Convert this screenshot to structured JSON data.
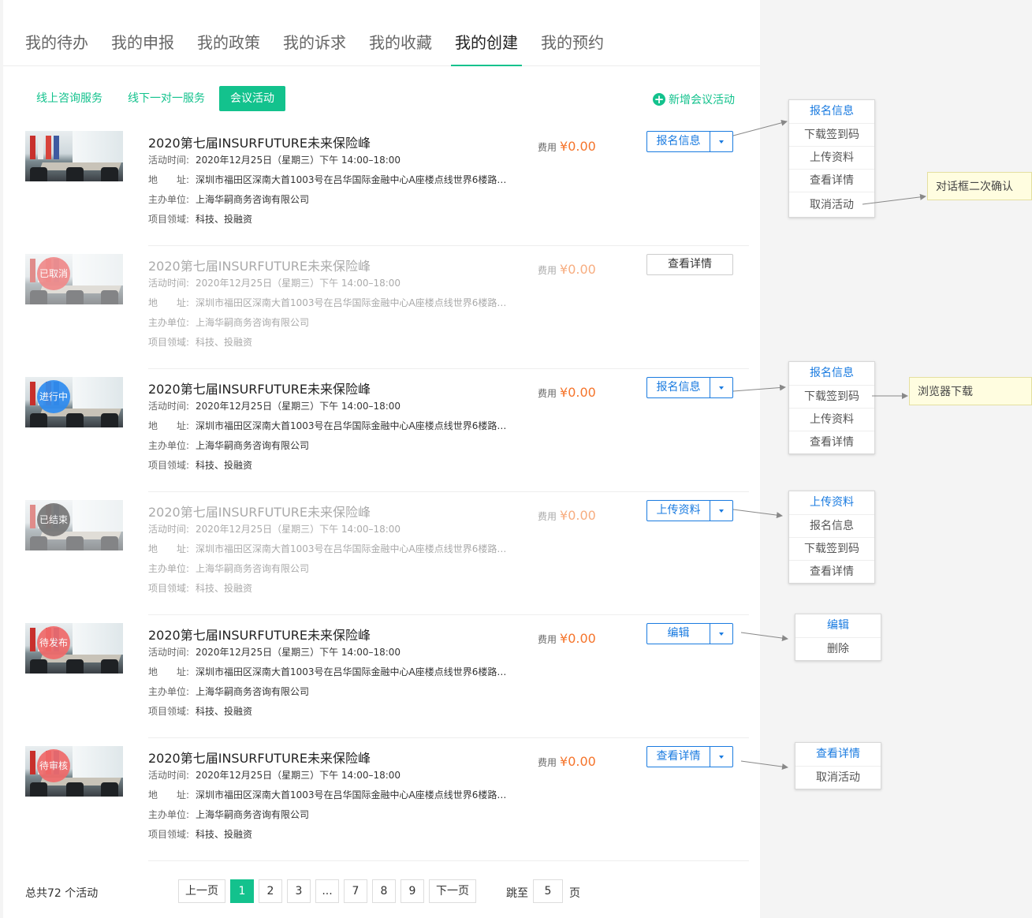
{
  "tabs": [
    "我的待办",
    "我的申报",
    "我的政策",
    "我的诉求",
    "我的收藏",
    "我的创建",
    "我的预约"
  ],
  "active_tab": "我的创建",
  "subtabs": [
    "线上咨询服务",
    "线下一对一服务",
    "会议活动"
  ],
  "active_subtab": "会议活动",
  "add_label": "新增会议活动",
  "labels": {
    "time": "活动时间:",
    "addr": "地　　址:",
    "org": "主办单位:",
    "field": "项目领域:",
    "fee": "费用"
  },
  "activities": [
    {
      "title": "2020第七届INSURFUTURE未来保险峰",
      "time": "2020年12月25日（星期三）下午 14:00–18:00",
      "address": "深圳市福田区深南大首1003号在吕华国际金融中心A座楼点线世界6楼路…",
      "organizer": "上海华嗣商务咨询有限公司",
      "field": "科技、投融资",
      "fee": "¥0.00",
      "status": "",
      "button": "报名信息",
      "menu": [
        "报名信息",
        "下载签到码",
        "上传资料",
        "查看详情",
        "取消活动"
      ],
      "note": "对话框二次确认"
    },
    {
      "title": "2020第七届INSURFUTURE未来保险峰",
      "time": "2020年12月25日（星期三）下午 14:00–18:00",
      "address": "深圳市福田区深南大首1003号在吕华国际金融中心A座楼点线世界6楼路…",
      "organizer": "上海华嗣商务咨询有限公司",
      "field": "科技、投融资",
      "fee": "¥0.00",
      "status": "已取消",
      "button": "查看详情",
      "menu": [],
      "note": ""
    },
    {
      "title": "2020第七届INSURFUTURE未来保险峰",
      "time": "2020年12月25日（星期三）下午 14:00–18:00",
      "address": "深圳市福田区深南大首1003号在吕华国际金融中心A座楼点线世界6楼路…",
      "organizer": "上海华嗣商务咨询有限公司",
      "field": "科技、投融资",
      "fee": "¥0.00",
      "status": "进行中",
      "button": "报名信息",
      "menu": [
        "报名信息",
        "下载签到码",
        "上传资料",
        "查看详情"
      ],
      "note": "浏览器下载"
    },
    {
      "title": "2020第七届INSURFUTURE未来保险峰",
      "time": "2020年12月25日（星期三）下午 14:00–18:00",
      "address": "深圳市福田区深南大首1003号在吕华国际金融中心A座楼点线世界6楼路…",
      "organizer": "上海华嗣商务咨询有限公司",
      "field": "科技、投融资",
      "fee": "¥0.00",
      "status": "已结束",
      "button": "上传资料",
      "menu": [
        "上传资料",
        "报名信息",
        "下载签到码",
        "查看详情"
      ],
      "note": ""
    },
    {
      "title": "2020第七届INSURFUTURE未来保险峰",
      "time": "2020年12月25日（星期三）下午 14:00–18:00",
      "address": "深圳市福田区深南大首1003号在吕华国际金融中心A座楼点线世界6楼路…",
      "organizer": "上海华嗣商务咨询有限公司",
      "field": "科技、投融资",
      "fee": "¥0.00",
      "status": "待发布",
      "button": "编辑",
      "menu": [
        "编辑",
        "删除"
      ],
      "note": ""
    },
    {
      "title": "2020第七届INSURFUTURE未来保险峰",
      "time": "2020年12月25日（星期三）下午 14:00–18:00",
      "address": "深圳市福田区深南大首1003号在吕华国际金融中心A座楼点线世界6楼路…",
      "organizer": "上海华嗣商务咨询有限公司",
      "field": "科技、投融资",
      "fee": "¥0.00",
      "status": "待审核",
      "button": "查看详情",
      "menu": [
        "查看详情",
        "取消活动"
      ],
      "note": ""
    }
  ],
  "pagination": {
    "total": "总共72 个活动",
    "prev": "上一页",
    "next": "下一页",
    "pages": [
      "1",
      "2",
      "3",
      "...",
      "7",
      "8",
      "9"
    ],
    "current": "1",
    "jump_label": "跳至",
    "jump_value": "5",
    "page_unit": "页"
  },
  "colors": {
    "accent": "#13c28d",
    "link": "#1a7be0",
    "price": "#f5742b",
    "status_cancelled": "#f08a8a",
    "status_running": "#2f8cf0",
    "status_ended": "#777777",
    "status_pending_publish": "#f06a6a",
    "status_pending_review": "#f06a6a"
  }
}
